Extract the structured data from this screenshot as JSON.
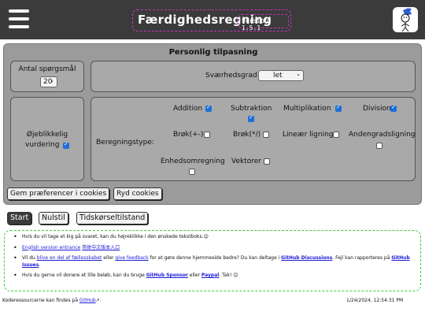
{
  "header": {
    "title": "Færdighedsregning",
    "version": "version: 1.5.1"
  },
  "settings": {
    "title": "Personlig tilpasning",
    "question_count_label": "Antal spørgsmål",
    "question_count_value": "20",
    "difficulty_label": "Sværhedsgrad",
    "difficulty_value": "let",
    "instant_label_1": "Øjeblikkelig",
    "instant_label_2": "vurdering",
    "instant_checked": true,
    "calc_type_label": "Beregningstype:",
    "types": [
      {
        "label": "Addition",
        "checked": true
      },
      {
        "label": "Subtraktion",
        "checked": true
      },
      {
        "label": "Multiplikation",
        "checked": true
      },
      {
        "label": "Division",
        "checked": true
      },
      {
        "label": "Brøk(+-)",
        "checked": false
      },
      {
        "label": "Brøk(*/)",
        "checked": false
      },
      {
        "label": "Lineær ligning",
        "checked": false
      },
      {
        "label": "Andengradsligning",
        "checked": false
      },
      {
        "label": "Enhedsomregning",
        "checked": false
      },
      {
        "label": "Vektorer",
        "checked": false
      }
    ],
    "save_cookies_label": "Gem præferencer i cookies",
    "clear_cookies_label": "Ryd cookies"
  },
  "controls": {
    "start_label": "Start",
    "reset_label": "Nulstil",
    "time_label": "Tidskørseltilstand"
  },
  "info": {
    "line1": "Hvis du vil tage et kig på svaret, kan du højreklikke i den ønskede tekstboks.😉",
    "line2_link1": "English version entrance",
    "line2_link2": "简体中文版本入口",
    "line3_a": "Vil du ",
    "line3_link1": "blive en del af fællesskabet",
    "line3_b": " eller ",
    "line3_link2": "give feedback",
    "line3_c": " for at gøre denne hjemmeside bedre? Du kan deltage i ",
    "line3_link3": "GitHub Discussions",
    "line3_d": ". Fejl kan rapporteres på ",
    "line3_link4": "GitHub Issues",
    "line3_e": ".",
    "line4_a": "Hvis du gerne vil donere et lille beløb, kan du bruge ",
    "line4_link1": "GitHub Sponsor",
    "line4_b": " eller ",
    "line4_link2": "Paypal",
    "line4_c": ". Tak! 😊"
  },
  "footer": {
    "source_text": "Koderessourcerne kan findes på ",
    "source_link": "GitHub",
    "timestamp": "1/24/2024, 12:54:31 PM"
  }
}
